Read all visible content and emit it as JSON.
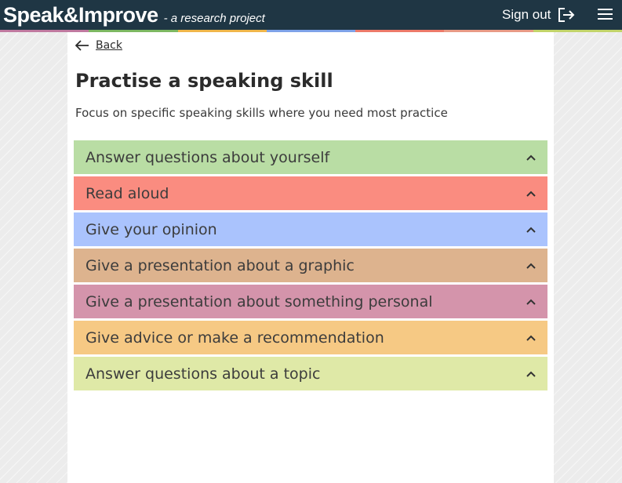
{
  "header": {
    "brand_name": "Speak&Improve",
    "brand_tagline": "- a research project",
    "sign_out_label": "Sign out",
    "icons": {
      "sign_out": "sign-out-icon",
      "menu": "hamburger-menu-icon"
    },
    "background_color": "#1f3644",
    "stripe_colors": [
      "#c07aa0",
      "#7db862",
      "#f0b64a",
      "#7ea2e8",
      "#ec7a6a",
      "#e89a86",
      "#c2d46a"
    ]
  },
  "nav": {
    "back_label": "Back",
    "back_icon": "arrow-left-icon"
  },
  "page": {
    "title": "Practise a speaking skill",
    "subtitle": "Focus on specific speaking skills where you need most practice"
  },
  "skills": [
    {
      "label": "Answer questions about yourself",
      "color": "#b9dda4",
      "icon": "chevron-up-icon"
    },
    {
      "label": "Read aloud",
      "color": "#fa8c80",
      "icon": "chevron-up-icon"
    },
    {
      "label": "Give your opinion",
      "color": "#aac3fd",
      "icon": "chevron-up-icon"
    },
    {
      "label": "Give a presentation about a graphic",
      "color": "#ddb38e",
      "icon": "chevron-up-icon"
    },
    {
      "label": "Give a presentation about something personal",
      "color": "#d494ab",
      "icon": "chevron-up-icon"
    },
    {
      "label": "Give advice or make a recommendation",
      "color": "#f6c984",
      "icon": "chevron-up-icon"
    },
    {
      "label": "Answer questions about a topic",
      "color": "#dfe9a7",
      "icon": "chevron-up-icon"
    }
  ]
}
